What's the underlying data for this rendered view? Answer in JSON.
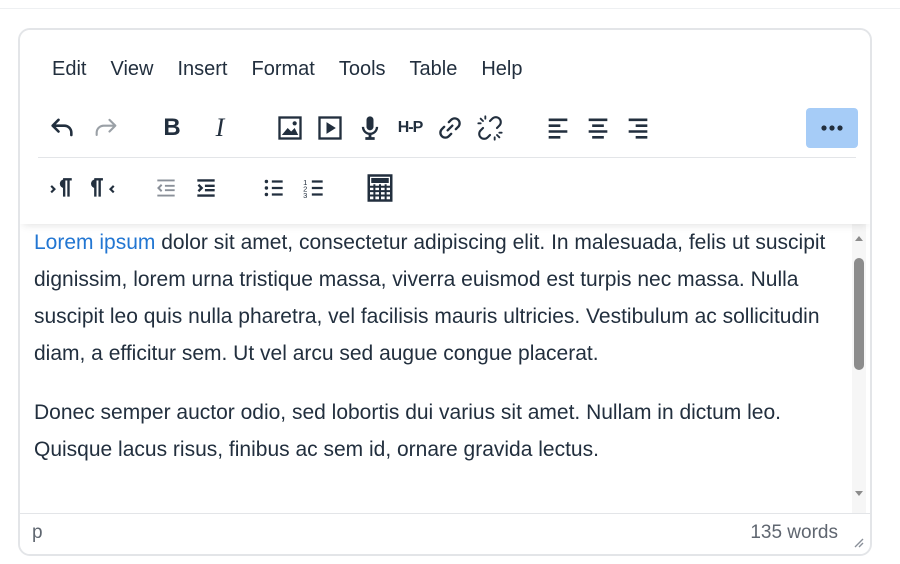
{
  "menubar": {
    "items": [
      "Edit",
      "View",
      "Insert",
      "Format",
      "Tools",
      "Table",
      "Help"
    ]
  },
  "toolbar": {
    "row1": [
      "undo-icon",
      "redo-icon",
      "bold-icon",
      "italic-icon",
      "image-icon",
      "media-icon",
      "microphone-icon",
      "h5p-icon",
      "link-icon",
      "unlink-icon",
      "align-left-icon",
      "align-center-icon",
      "align-right-icon"
    ],
    "row2": [
      "ltr-icon",
      "rtl-icon",
      "outdent-icon",
      "indent-icon",
      "bullet-list-icon",
      "numbered-list-icon",
      "calculator-icon"
    ],
    "more_icon": "more-icon",
    "bold_label": "B",
    "italic_label": "I",
    "h5p_label": "H-P",
    "more_active_color": "#a6ccf7"
  },
  "content": {
    "p1_link": "Lorem ipsum",
    "p1_rest": " dolor sit amet, consectetur adipiscing elit. In malesuada, felis ut suscipit dignissim, lorem urna tristique massa, viverra euismod est turpis nec massa. Nulla suscipit leo quis nulla pharetra, vel facilisis mauris ultricies. Vestibulum ac sollicitudin diam, a efficitur sem. Ut vel arcu sed augue congue placerat.",
    "p2": "Donec semper auctor odio, sed lobortis dui varius sit amet. Nullam in dictum leo. Quisque lacus risus, finibus ac sem id, ornare gravida lectus.",
    "link_color": "#2276d2"
  },
  "statusbar": {
    "path": "p",
    "word_count": "135 words"
  }
}
